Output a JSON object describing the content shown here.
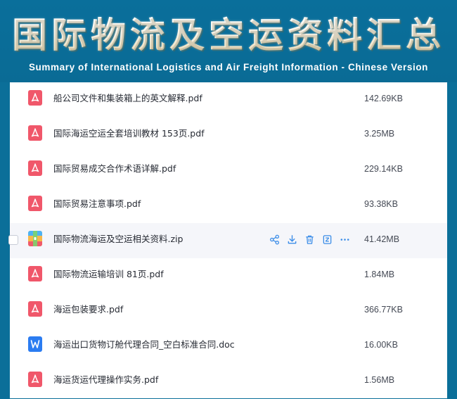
{
  "header": {
    "title": "国际物流及空运资料汇总",
    "subtitle": "Summary of International Logistics and Air Freight Information - Chinese Version"
  },
  "colors": {
    "banner": "#0b6f99",
    "pdf_icon": "#f0576a",
    "doc_icon": "#2b7cf1",
    "action_icon": "#3d8ee8",
    "row_hover": "#f5f6fa"
  },
  "files": [
    {
      "name": "船公司文件和集装箱上的英文解释.pdf",
      "size": "142.69KB",
      "icon": "pdf-icon"
    },
    {
      "name": "国际海运空运全套培训教材 153页.pdf",
      "size": "3.25MB",
      "icon": "pdf-icon"
    },
    {
      "name": "国际贸易成交合作术语详解.pdf",
      "size": "229.14KB",
      "icon": "pdf-icon"
    },
    {
      "name": "国际贸易注意事项.pdf",
      "size": "93.38KB",
      "icon": "pdf-icon"
    },
    {
      "name": "国际物流海运及空运相关资料.zip",
      "size": "41.42MB",
      "icon": "zip-icon"
    },
    {
      "name": "国际物流运输培训 81页.pdf",
      "size": "1.84MB",
      "icon": "pdf-icon"
    },
    {
      "name": "海运包装要求.pdf",
      "size": "366.77KB",
      "icon": "pdf-icon"
    },
    {
      "name": "海运出口货物订舱代理合同_空白标准合同.doc",
      "size": "16.00KB",
      "icon": "doc-icon"
    },
    {
      "name": "海运货运代理操作实务.pdf",
      "size": "1.56MB",
      "icon": "pdf-icon"
    }
  ],
  "row_actions": [
    "share-icon",
    "download-icon",
    "delete-icon",
    "open-icon",
    "more-icon"
  ]
}
